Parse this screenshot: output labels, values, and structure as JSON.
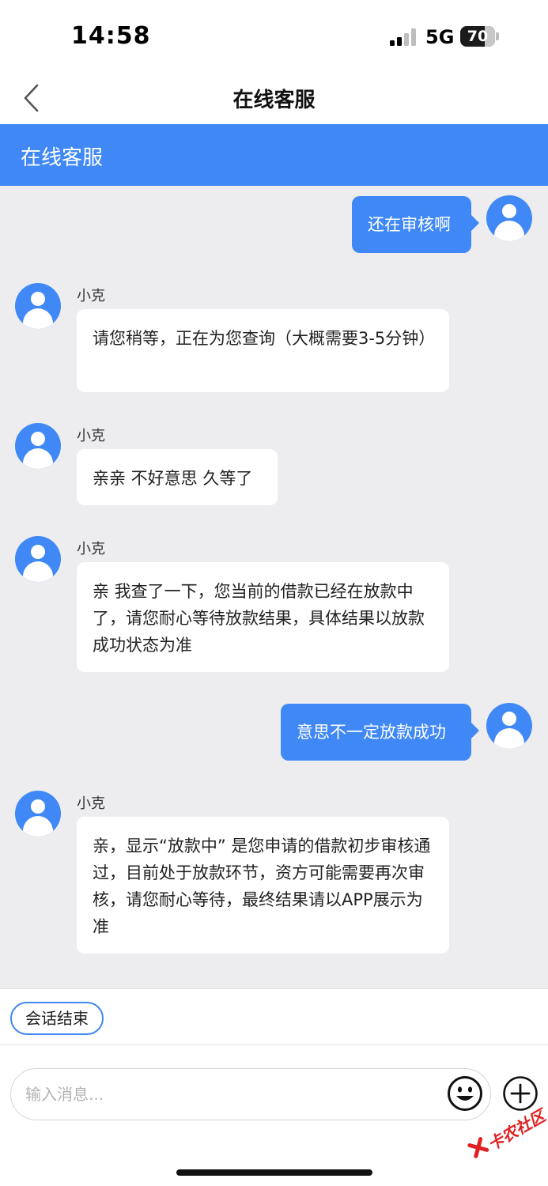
{
  "status_bar": {
    "time": "14:58",
    "network": "5G",
    "battery": "70",
    "battery_level": 0.7
  },
  "nav": {
    "title": "在线客服"
  },
  "header": {
    "title": "在线客服"
  },
  "messages": [
    {
      "side": "out",
      "text": "还在审核啊"
    },
    {
      "side": "in",
      "sender": "小克",
      "text": "请您稍等，正在为您查询（大概需要3-5分钟）"
    },
    {
      "side": "in",
      "sender": "小克",
      "text": "亲亲 不好意思 久等了"
    },
    {
      "side": "in",
      "sender": "小克",
      "text": "亲 我查了一下，您当前的借款已经在放款中了，请您耐心等待放款结果，具体结果以放款成功状态为准"
    },
    {
      "side": "out",
      "text": "意思不一定放款成功"
    },
    {
      "side": "in",
      "sender": "小克",
      "text": "亲，显示“放款中” 是您申请的借款初步审核通过，目前处于放款环节，资方可能需要再次审核，请您耐心等待，最终结果请以APP展示为准"
    }
  ],
  "quick_actions": {
    "end_session": "会话结束"
  },
  "input": {
    "placeholder": "输入消息..."
  },
  "watermark": {
    "text": "卡农社区"
  },
  "colors": {
    "primary": "#3f88f6",
    "chat_bg": "#ededf0"
  }
}
